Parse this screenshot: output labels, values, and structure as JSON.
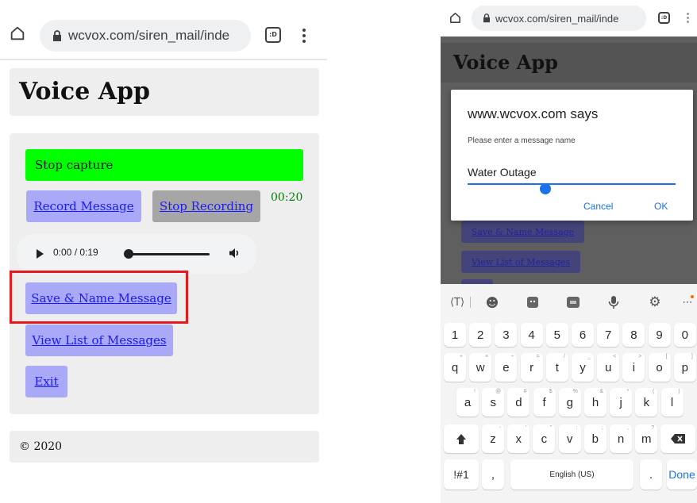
{
  "left": {
    "url": "wcvox.com/siren_mail/inde",
    "tab_count": ":D",
    "page_title": "Voice App",
    "status_text": "Stop capture",
    "record_label": "Record Message",
    "stop_label": "Stop Recording",
    "timer": "00:20",
    "audio_time": "0:00 / 0:19",
    "audio_progress": 0,
    "save_label": "Save & Name Message",
    "view_label": "View List of Messages",
    "exit_label": "Exit",
    "footer": "© 2020"
  },
  "right": {
    "url": "wcvox.com/siren_mail/inde",
    "tab_count": ":D",
    "page_title": "Voice App",
    "behind_save": "Save & Name Message",
    "behind_view": "View List of Messages",
    "dialog": {
      "title": "www.wcvox.com says",
      "prompt": "Please enter a message name",
      "value": "Water Outage",
      "cancel": "Cancel",
      "ok": "OK"
    },
    "keyboard": {
      "numbers": [
        "1",
        "2",
        "3",
        "4",
        "5",
        "6",
        "7",
        "8",
        "9",
        "0"
      ],
      "row1": [
        "q",
        "w",
        "e",
        "r",
        "t",
        "y",
        "u",
        "i",
        "o",
        "p"
      ],
      "row1_alt": [
        "+",
        "×",
        "÷",
        "=",
        "/",
        "_",
        "<",
        ">",
        "[",
        "]"
      ],
      "row2": [
        "a",
        "s",
        "d",
        "f",
        "g",
        "h",
        "j",
        "k",
        "l"
      ],
      "row2_alt": [
        "!",
        "@",
        "#",
        "$",
        "%",
        "&",
        "*",
        "(",
        ")"
      ],
      "row3": [
        "z",
        "x",
        "c",
        "v",
        "b",
        "n",
        "m"
      ],
      "row3_alt": [
        "-",
        "'",
        "\"",
        ":",
        ";",
        ",",
        "?"
      ],
      "symbols_label": "!#1",
      "comma": ",",
      "space_label": "English (US)",
      "period": ".",
      "done_label": "Done"
    }
  },
  "colors": {
    "accent_blue": "#1a73e8",
    "green": "#00ff00",
    "button": "#a9a9f8",
    "highlight": "#e8191c"
  }
}
